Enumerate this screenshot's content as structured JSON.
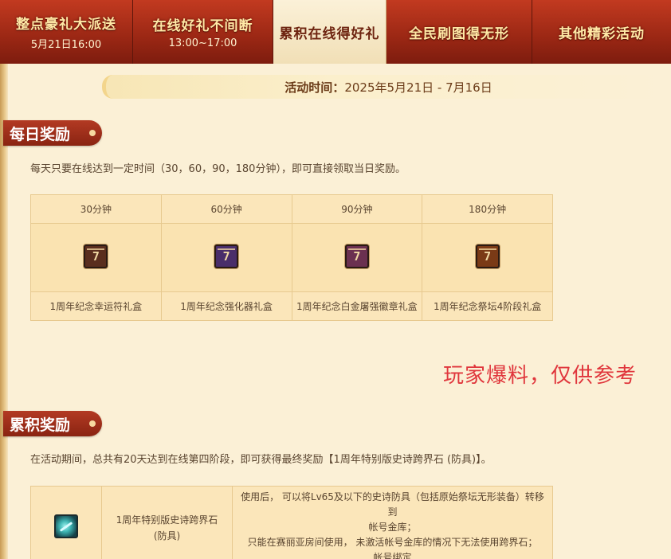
{
  "tabs": [
    {
      "title": "整点豪礼大派送",
      "sub": "5月21日16:00",
      "active": false
    },
    {
      "title": "在线好礼不间断",
      "sub": "13:00~17:00",
      "active": false
    },
    {
      "title": "累积在线得好礼",
      "sub": "",
      "active": true
    },
    {
      "title": "全民刷图得无形",
      "sub": "",
      "active": false
    },
    {
      "title": "其他精彩活动",
      "sub": "",
      "active": false
    }
  ],
  "banner": {
    "label": "活动时间：",
    "value": "2025年5月21日 - 7月16日"
  },
  "daily": {
    "title": "每日奖励",
    "desc": "每天只要在线达到一定时间（30，60，90，180分钟），即可直接领取当日奖励。",
    "rewards": [
      {
        "time": "30分钟",
        "name": "1周年纪念幸运符礼盒",
        "color": "#5a2e1e"
      },
      {
        "time": "60分钟",
        "name": "1周年纪念强化器礼盒",
        "color": "#4a2e6a"
      },
      {
        "time": "90分钟",
        "name": "1周年纪念白金屠强徽章礼盒",
        "color": "#6b3050"
      },
      {
        "time": "180分钟",
        "name": "1周年纪念祭坛4阶段礼盒",
        "color": "#7a3a16"
      }
    ]
  },
  "watermark": "玩家爆料，仅供参考",
  "cumulative": {
    "title": "累积奖励",
    "desc": "在活动期间，总共有20天达到在线第四阶段，即可获得最终奖励【1周年特别版史诗跨界石 (防具)】。",
    "item": {
      "icon": "crossing-stone-icon",
      "name_line1": "1周年特别版史诗跨界石",
      "name_line2": "(防具)",
      "desc_lines": [
        "使用后， 可以将Lv65及以下的史诗防具（包括原始祭坛无形装备）转移到",
        "帐号金库；",
        "只能在赛丽亚房间使用， 未激活帐号金库的情况下无法使用跨界石；",
        "帐号绑定"
      ]
    }
  }
}
